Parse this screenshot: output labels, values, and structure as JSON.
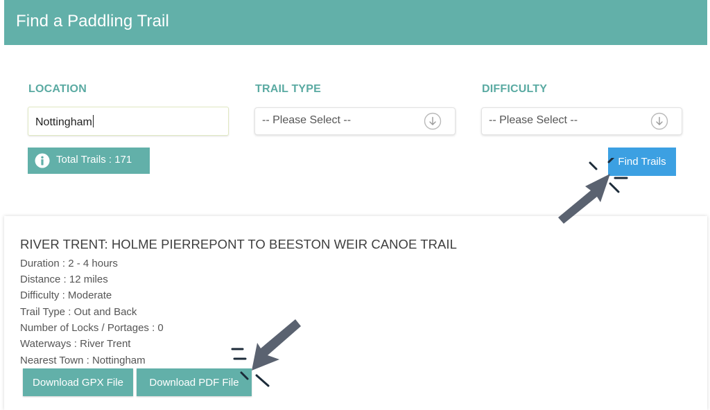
{
  "header": {
    "title": "Find a Paddling Trail"
  },
  "filters": {
    "location": {
      "label": "LOCATION",
      "value": "Nottingham"
    },
    "trail_type": {
      "label": "TRAIL TYPE",
      "selected": "-- Please Select --"
    },
    "difficulty": {
      "label": "DIFFICULTY",
      "selected": "-- Please Select --"
    }
  },
  "total": {
    "text": "Total Trails : 171",
    "count": 171
  },
  "find_button": {
    "label": "Find Trails"
  },
  "result": {
    "title": "RIVER TRENT: HOLME PIERREPONT TO BEESTON WEIR CANOE TRAIL",
    "details": [
      "Duration : 2 - 4 hours",
      "Distance : 12 miles",
      "Difficulty : Moderate",
      "Trail Type : Out and Back",
      "Number of Locks / Portages : 0",
      "Waterways : River Trent",
      "Nearest Town : Nottingham"
    ],
    "download_gpx_label": "Download GPX File",
    "download_pdf_label": "Download PDF File"
  },
  "colors": {
    "header": "#62b0a9",
    "label": "#5aaaa2",
    "find_button": "#3ca0e2",
    "download_button": "#62b0a9",
    "pointer": "#5a6270"
  },
  "icons": [
    "info-icon",
    "chevron-down-circle-icon",
    "pointer-arrow-icon",
    "click-burst-icon"
  ]
}
